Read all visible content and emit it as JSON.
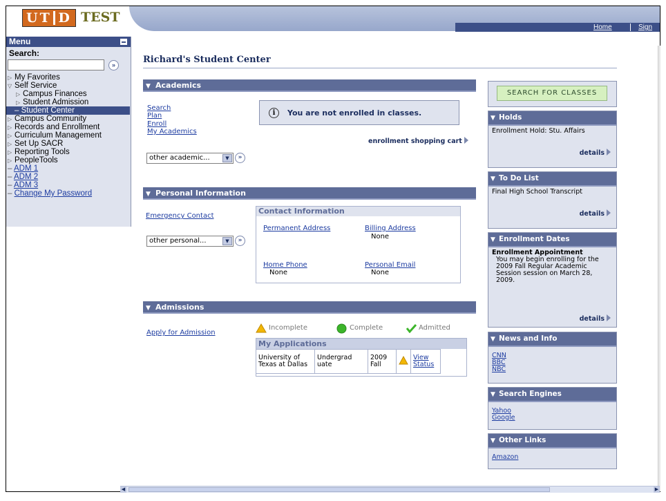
{
  "header": {
    "logo_letters": "UT D",
    "logo_test": "TEST",
    "nav_home": "Home",
    "nav_signout": "Sign out"
  },
  "sidebar": {
    "menu_title": "Menu",
    "search_label": "Search:",
    "search_value": "",
    "items": [
      {
        "label": "My Favorites"
      },
      {
        "label": "Self Service"
      },
      {
        "label": "Campus Finances"
      },
      {
        "label": "Student Admission"
      },
      {
        "label": "Student Center"
      },
      {
        "label": "Campus Community"
      },
      {
        "label": "Records and Enrollment"
      },
      {
        "label": "Curriculum Management"
      },
      {
        "label": "Set Up SACR"
      },
      {
        "label": "Reporting Tools"
      },
      {
        "label": "PeopleTools"
      },
      {
        "label": "ADM 1"
      },
      {
        "label": "ADM 2"
      },
      {
        "label": "ADM 3"
      },
      {
        "label": "Change My Password"
      }
    ]
  },
  "page": {
    "title": "Richard's Student Center"
  },
  "academics": {
    "header": "Academics",
    "links": [
      "Search",
      "Plan",
      "Enroll",
      "My Academics"
    ],
    "notice": "You are not enrolled in classes.",
    "cart_link": "enrollment shopping cart",
    "dropdown": "other academic..."
  },
  "personal": {
    "header": "Personal Information",
    "emergency_link": "Emergency Contact",
    "dropdown": "other personal...",
    "contact_header": "Contact Information",
    "permanent_address": "Permanent Address",
    "billing_address": "Billing Address",
    "billing_value": "None",
    "home_phone": "Home Phone",
    "home_phone_value": "None",
    "personal_email": "Personal Email",
    "personal_email_value": "None"
  },
  "admissions": {
    "header": "Admissions",
    "apply_link": "Apply for Admission",
    "legend_incomplete": "Incomplete",
    "legend_complete": "Complete",
    "legend_admitted": "Admitted",
    "apps_header": "My Applications",
    "app_institution": "University of Texas at Dallas",
    "app_career": "Undergrad uate",
    "app_term": "2009 Fall",
    "app_view": "View Status"
  },
  "right": {
    "search_classes": "SEARCH FOR CLASSES",
    "holds_header": "Holds",
    "holds_item": "Enrollment Hold: Stu. Affairs",
    "todo_header": "To Do List",
    "todo_item": "Final High School Transcript",
    "details": "details",
    "enroll_header": "Enrollment Dates",
    "enroll_title": "Enrollment Appointment",
    "enroll_text": "You may begin enrolling for the 2009 Fall Regular Academic Session session on March 28, 2009.",
    "news_header": "News and Info",
    "news_links": [
      "CNN",
      "BBC",
      "NBC"
    ],
    "search_header": "Search Engines",
    "search_links": [
      "Yahoo",
      "Google"
    ],
    "other_header": "Other Links",
    "other_links": [
      "Amazon"
    ]
  },
  "colors": {
    "section_header": "#5e6c98",
    "nav_dark": "#3c4f88",
    "panel_bg": "#dfe3ee",
    "link": "#1c3ba0",
    "logo_orange": "#d2691e",
    "search_button_bg": "#d6f0c0"
  }
}
